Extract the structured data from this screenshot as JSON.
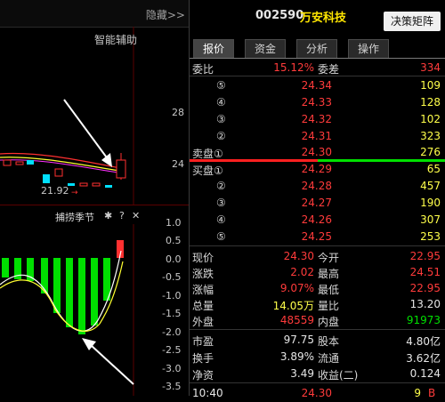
{
  "left": {
    "hide_label": "隐藏>>",
    "smart_assist": "智能辅助",
    "main_yticks": [
      "28",
      "24"
    ],
    "low_marker": "21.92",
    "sub_title": "捕捞季节",
    "sub_tools": {
      "gear": "✱",
      "help": "?",
      "close": "✕"
    },
    "sub_yticks": [
      "1.0",
      "0.5",
      "0.0",
      "-0.5",
      "-1.0",
      "-1.5",
      "-2.0",
      "-2.5",
      "-3.0",
      "-3.5"
    ]
  },
  "header": {
    "code": "002590",
    "name": "万安科技",
    "decision_button": "决策矩阵"
  },
  "tabs": [
    "报价",
    "资金",
    "分析",
    "操作"
  ],
  "ratio": {
    "label1": "委比",
    "value1": "15.12%",
    "label2": "委差",
    "value2": "334"
  },
  "sell_orders": [
    {
      "level": "⑤",
      "price": "24.34",
      "volume": "109"
    },
    {
      "level": "④",
      "price": "24.33",
      "volume": "128"
    },
    {
      "level": "③",
      "price": "24.32",
      "volume": "102"
    },
    {
      "level": "②",
      "price": "24.31",
      "volume": "323"
    },
    {
      "level": "卖盘①",
      "price": "24.30",
      "volume": "276"
    }
  ],
  "buy_orders": [
    {
      "level": "买盘①",
      "price": "24.29",
      "volume": "65"
    },
    {
      "level": "②",
      "price": "24.28",
      "volume": "457"
    },
    {
      "level": "③",
      "price": "24.27",
      "volume": "190"
    },
    {
      "level": "④",
      "price": "24.26",
      "volume": "307"
    },
    {
      "level": "⑤",
      "price": "24.25",
      "volume": "253"
    }
  ],
  "quote": [
    {
      "l1": "现价",
      "v1": "24.30",
      "l2": "今开",
      "v2": "22.95"
    },
    {
      "l1": "涨跌",
      "v1": "2.02",
      "l2": "最高",
      "v2": "24.51"
    },
    {
      "l1": "涨幅",
      "v1": "9.07%",
      "l2": "最低",
      "v2": "22.95"
    },
    {
      "l1": "总量",
      "v1": "14.05万",
      "l2": "量比",
      "v2": "13.20"
    },
    {
      "l1": "外盘",
      "v1": "48559",
      "l2": "内盘",
      "v2": "91973"
    }
  ],
  "fundamentals": [
    {
      "l1": "市盈",
      "v1": "97.75",
      "l2": "股本",
      "v2": "4.80亿"
    },
    {
      "l1": "换手",
      "v1": "3.89%",
      "l2": "流通",
      "v2": "3.62亿"
    },
    {
      "l1": "净资",
      "v1": "3.49",
      "l2": "收益(二)",
      "v2": "0.124"
    }
  ],
  "tick": {
    "time": "10:40",
    "price": "24.30",
    "volume": "9",
    "side": "B"
  },
  "colors": {
    "up": "#ff3b3b",
    "down": "#00e000",
    "neutral": "#e6e6e6",
    "yellow": "#ffff4a"
  }
}
